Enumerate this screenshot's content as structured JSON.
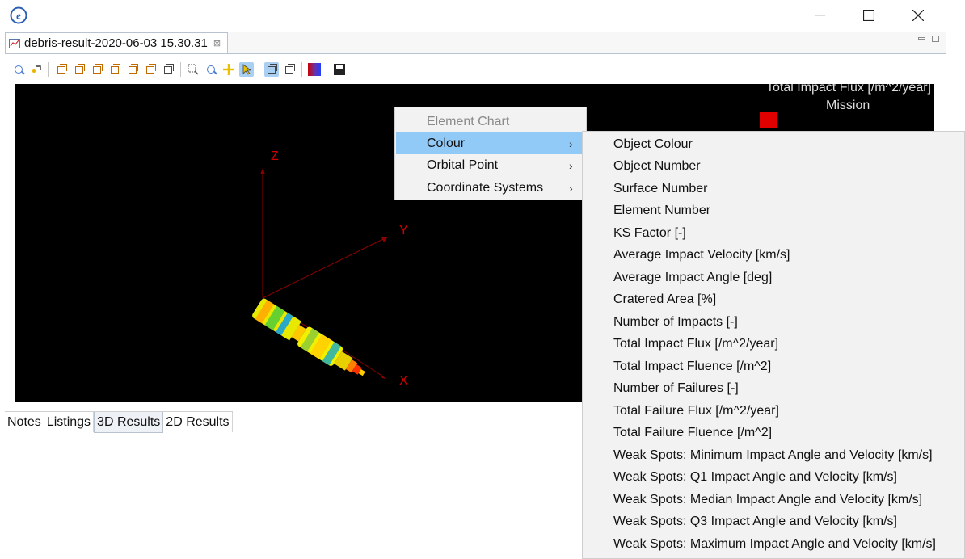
{
  "window": {
    "app_icon": "e-logo-icon",
    "controls": [
      "minimize-icon",
      "maximize-icon",
      "close-icon"
    ]
  },
  "editor": {
    "tab_title": "debris-result-2020-06-03 15.30.31",
    "tab_close_glyph": "⊠"
  },
  "toolbar": {
    "icons": [
      "zoom-fit-icon",
      "pick-icon",
      "view-front-icon",
      "view-back-icon",
      "view-left-icon",
      "view-right-icon",
      "view-top-icon",
      "view-bottom-icon",
      "view-iso-icon",
      "zoom-box-icon",
      "zoom-icon",
      "pan-icon",
      "select-icon",
      "wireframe-icon",
      "shaded-icon",
      "colour-map-icon",
      "save-icon"
    ],
    "active": [
      "select-icon",
      "wireframe-icon"
    ]
  },
  "viewport": {
    "legend_title": "Total Impact Flux [/m^2/year]",
    "legend_subtitle": "Mission",
    "axes": {
      "x": "X",
      "y": "Y",
      "z": "Z"
    },
    "axis_color": "#8b0000",
    "axis_label_color": "#d00000"
  },
  "bottom_tabs": [
    {
      "label": "Notes",
      "selected": false
    },
    {
      "label": "Listings",
      "selected": false
    },
    {
      "label": "3D Results",
      "selected": true
    },
    {
      "label": "2D Results",
      "selected": false
    }
  ],
  "context_menu": {
    "items": [
      {
        "label": "Element Chart",
        "enabled": false,
        "submenu": false
      },
      {
        "label": "Colour",
        "enabled": true,
        "submenu": true,
        "highlighted": true
      },
      {
        "label": "Orbital Point",
        "enabled": true,
        "submenu": true
      },
      {
        "label": "Coordinate Systems",
        "enabled": true,
        "submenu": true
      }
    ],
    "submenu_glyph": "›"
  },
  "colour_submenu": {
    "items": [
      "Object Colour",
      "Object Number",
      "Surface Number",
      "Element Number",
      "KS Factor [-]",
      "Average Impact Velocity [km/s]",
      "Average Impact Angle [deg]",
      "Cratered Area [%]",
      "Number of Impacts [-]",
      "Total Impact Flux [/m^2/year]",
      "Total Impact Fluence [/m^2]",
      "Number of Failures [-]",
      "Total Failure Flux [/m^2/year]",
      "Total Failure Fluence [/m^2]",
      "Weak Spots: Minimum Impact Angle and Velocity [km/s]",
      "Weak Spots: Q1 Impact Angle and Velocity [km/s]",
      "Weak Spots: Median Impact Angle and Velocity [km/s]",
      "Weak Spots: Q3 Impact Angle and Velocity [km/s]",
      "Weak Spots: Maximum Impact Angle and Velocity [km/s]"
    ]
  }
}
